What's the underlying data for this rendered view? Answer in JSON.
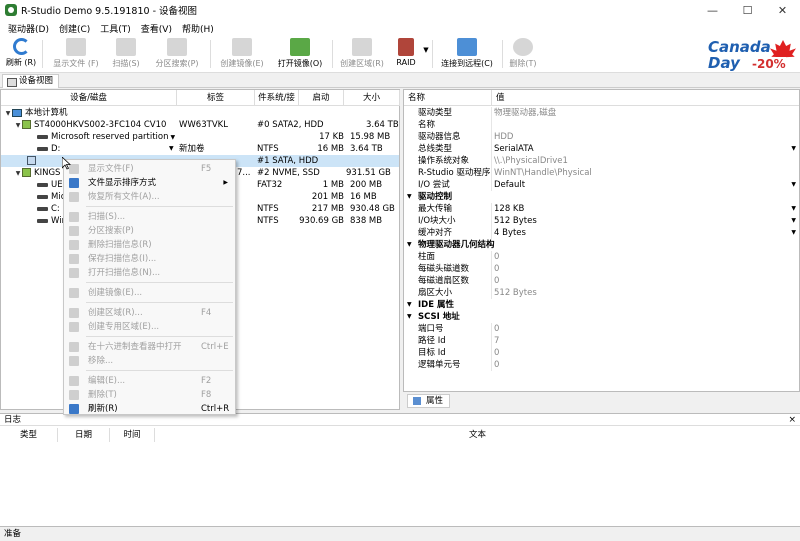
{
  "window": {
    "title": "R-Studio Demo 9.5.191810 - 设备视图"
  },
  "menu": [
    "驱动器(D)",
    "创建(C)",
    "工具(T)",
    "查看(V)",
    "帮助(H)"
  ],
  "toolbar": {
    "refresh": "刷新 (R)",
    "show_files": "显示文件 (F)",
    "scan": "扫描(S)",
    "partition_search": "分区搜索(P)",
    "create_image": "创建镜像(E)",
    "open_image": "打开镜像(O)",
    "create_region": "创建区域(R)",
    "raid": "RAID",
    "connect_remote": "连接到远程(C)",
    "delete": "删除(T)"
  },
  "ad": {
    "line1": "Canada",
    "line2": "Day",
    "pct": "-20%"
  },
  "tab": {
    "device_view": "设备视图"
  },
  "device_table": {
    "headers": {
      "device": "设备/磁盘",
      "label": "标签",
      "fs": "件系统/接",
      "start": "启动",
      "size": "大小"
    },
    "rows": [
      {
        "device": "本地计算机",
        "label": "",
        "fs": "",
        "start": "",
        "size": ""
      },
      {
        "device": "ST4000HKVS002-3FC104 CV10",
        "label": "WW63TVKL",
        "fs": "#0 SATA2, HDD",
        "start": "",
        "size": "3.64 TB"
      },
      {
        "device": "Microsoft reserved partition",
        "label": "",
        "fs": "",
        "start": "17 KB",
        "size": "15.98 MB"
      },
      {
        "device": "D:",
        "label": "新加卷",
        "fs": "NTFS",
        "start": "16 MB",
        "size": "3.64 TB"
      },
      {
        "device": "",
        "label": "",
        "fs": "#1 SATA, HDD",
        "start": "",
        "size": ""
      },
      {
        "device": "KINGS",
        "label": "7...",
        "fs": "#2 NVME, SSD",
        "start": "",
        "size": "931.51 GB"
      },
      {
        "device": "UEF",
        "label": "",
        "fs": "FAT32",
        "start": "1 MB",
        "size": "200 MB"
      },
      {
        "device": "Mic",
        "label": "",
        "fs": "",
        "start": "201 MB",
        "size": "16 MB"
      },
      {
        "device": "C:",
        "label": "",
        "fs": "NTFS",
        "start": "217 MB",
        "size": "930.48 GB"
      },
      {
        "device": "Win",
        "label": "",
        "fs": "NTFS",
        "start": "930.69 GB",
        "size": "838 MB"
      }
    ]
  },
  "context_menu": [
    {
      "label": "显示文件(F)",
      "shortcut": "F5",
      "enabled": false
    },
    {
      "label": "文件显示排序方式",
      "shortcut": "",
      "enabled": true,
      "submenu": true
    },
    {
      "label": "恢复所有文件(A)...",
      "shortcut": "",
      "enabled": false
    },
    {
      "label": "扫描(S)...",
      "shortcut": "",
      "enabled": false
    },
    {
      "label": "分区搜索(P)",
      "shortcut": "",
      "enabled": false
    },
    {
      "label": "删除扫描信息(R)",
      "shortcut": "",
      "enabled": false
    },
    {
      "label": "保存扫描信息(I)...",
      "shortcut": "",
      "enabled": false
    },
    {
      "label": "打开扫描信息(N)...",
      "shortcut": "",
      "enabled": false
    },
    {
      "label": "创建镜像(E)...",
      "shortcut": "",
      "enabled": false
    },
    {
      "label": "创建区域(R)...",
      "shortcut": "F4",
      "enabled": false
    },
    {
      "label": "创建专用区域(E)...",
      "shortcut": "",
      "enabled": false
    },
    {
      "label": "在十六进制查看器中打开",
      "shortcut": "Ctrl+E",
      "enabled": false
    },
    {
      "label": "移除...",
      "shortcut": "",
      "enabled": false
    },
    {
      "label": "编辑(E)...",
      "shortcut": "F2",
      "enabled": false
    },
    {
      "label": "删除(T)",
      "shortcut": "F8",
      "enabled": false
    },
    {
      "label": "刷新(R)",
      "shortcut": "Ctrl+R",
      "enabled": true
    }
  ],
  "properties": {
    "headers": {
      "name": "名称",
      "value": "值"
    },
    "rows": [
      {
        "name": "驱动类型",
        "value": "物理驱动器,磁盘",
        "group": false
      },
      {
        "name": "名称",
        "value": "",
        "group": false
      },
      {
        "name": "驱动器信息",
        "value": "HDD",
        "group": false
      },
      {
        "name": "总线类型",
        "value": "SerialATA",
        "group": false,
        "dropdown": true,
        "dark": true
      },
      {
        "name": "操作系统对象",
        "value": "\\\\.\\PhysicalDrive1",
        "group": false
      },
      {
        "name": "R-Studio 驱动程序",
        "value": "WinNT\\Handle\\Physical",
        "group": false
      },
      {
        "name": "I/O 尝试",
        "value": "Default",
        "group": false,
        "dropdown": true,
        "dark": true
      },
      {
        "name": "驱动控制",
        "value": "",
        "group": true
      },
      {
        "name": "最大传输",
        "value": "128 KB",
        "group": false,
        "dropdown": true,
        "dark": true
      },
      {
        "name": "I/O块大小",
        "value": "512 Bytes",
        "group": false,
        "dropdown": true,
        "dark": true
      },
      {
        "name": "缓冲对齐",
        "value": "4 Bytes",
        "group": false,
        "dropdown": true,
        "dark": true
      },
      {
        "name": "物理驱动器几何结构",
        "value": "",
        "group": true
      },
      {
        "name": "柱面",
        "value": "0",
        "group": false
      },
      {
        "name": "每磁头磁道数",
        "value": "0",
        "group": false
      },
      {
        "name": "每磁道扇区数",
        "value": "0",
        "group": false
      },
      {
        "name": "扇区大小",
        "value": "512 Bytes",
        "group": false
      },
      {
        "name": "IDE 属性",
        "value": "",
        "group": true
      },
      {
        "name": "SCSI 地址",
        "value": "",
        "group": true
      },
      {
        "name": "端口号",
        "value": "0",
        "group": false
      },
      {
        "name": "路径 Id",
        "value": "7",
        "group": false
      },
      {
        "name": "目标 Id",
        "value": "0",
        "group": false
      },
      {
        "name": "逻辑单元号",
        "value": "0",
        "group": false
      }
    ],
    "tab": "属性"
  },
  "log": {
    "title": "日志",
    "close": "×",
    "headers": {
      "type": "类型",
      "date": "日期",
      "time": "时间",
      "text": "文本"
    }
  },
  "status": {
    "text": "准备"
  }
}
